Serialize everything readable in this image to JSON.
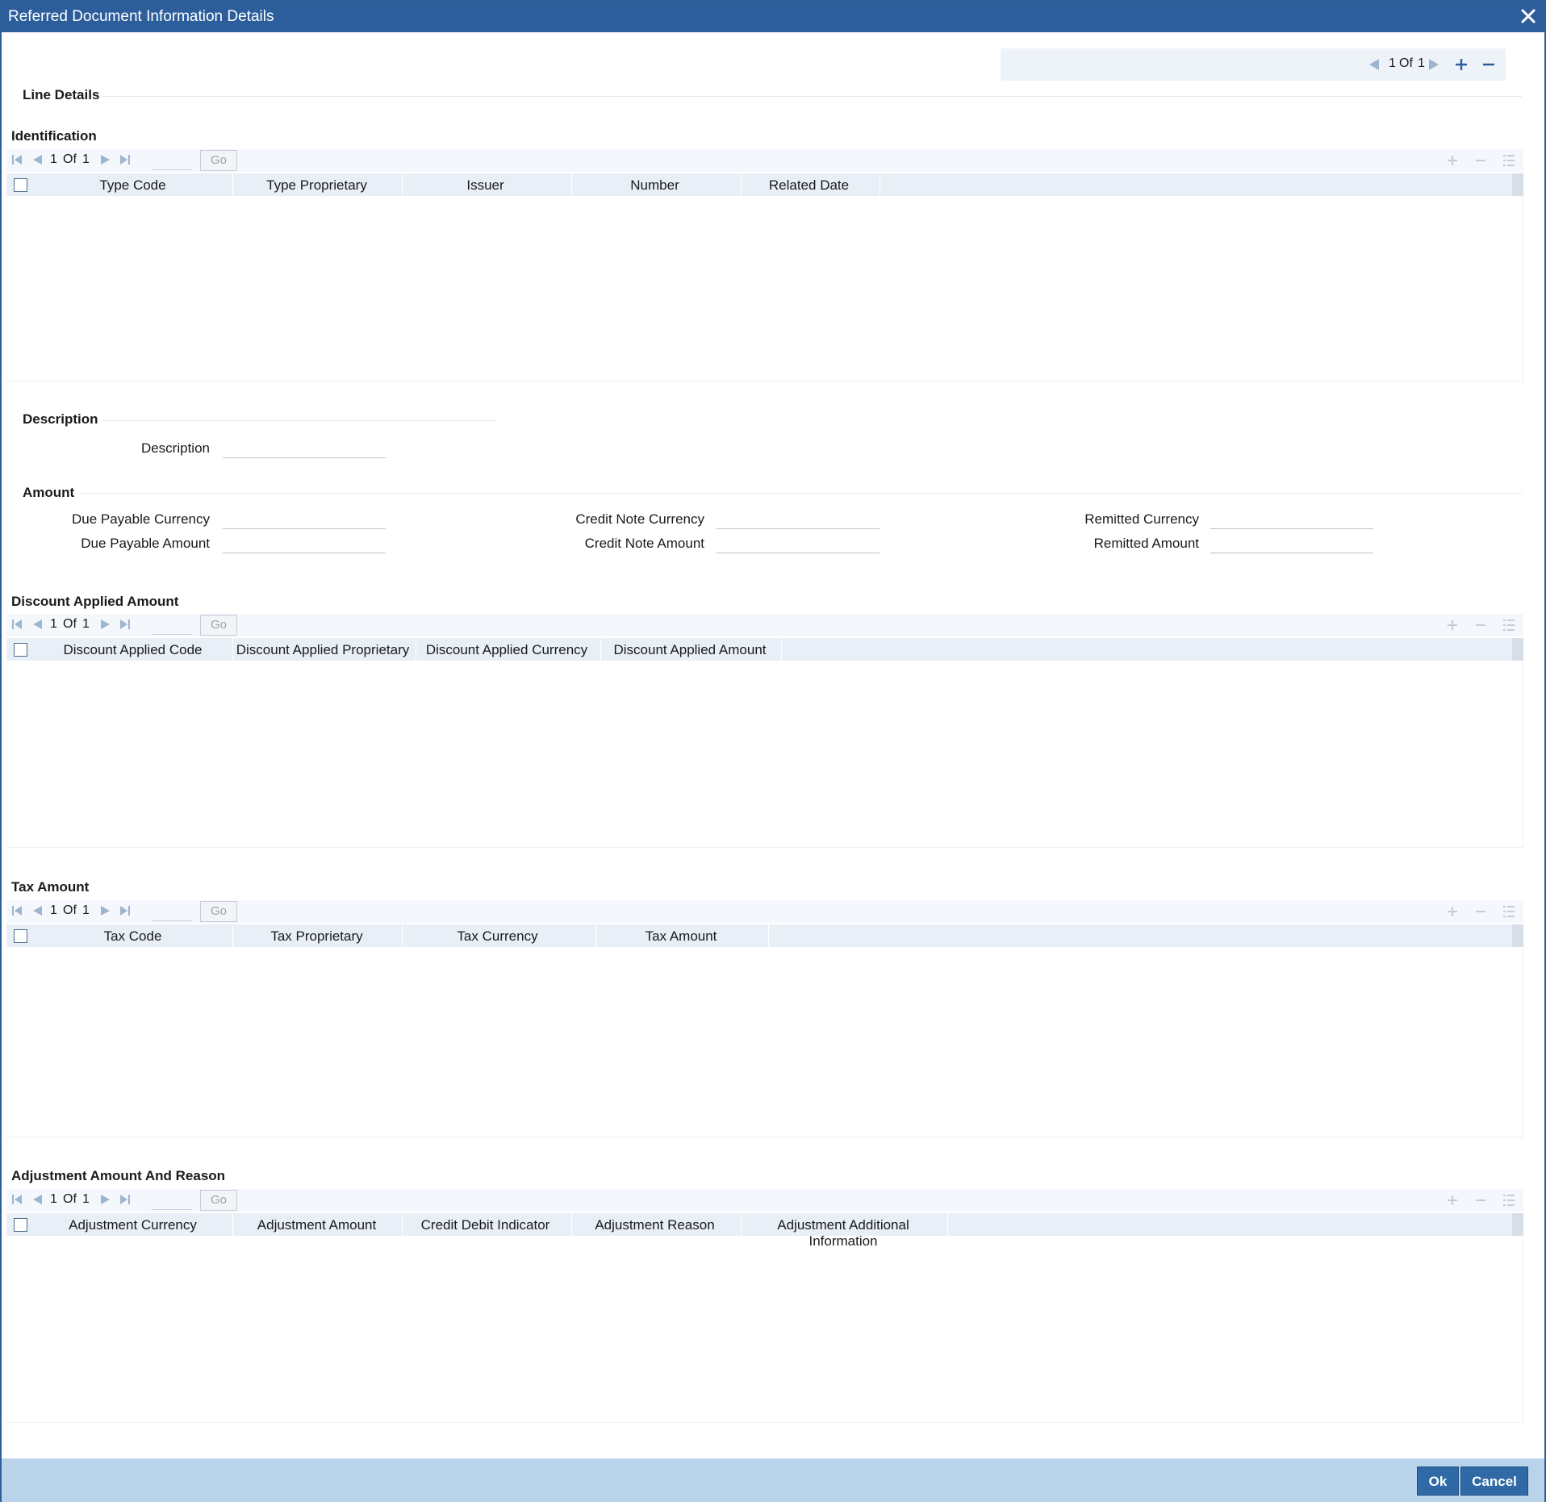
{
  "window": {
    "title": "Referred Document Information Details"
  },
  "record_nav": {
    "current": "1",
    "of_label": "Of",
    "total": "1"
  },
  "line_details": {
    "title": "Line Details"
  },
  "identification": {
    "title": "Identification",
    "pager": {
      "current": "1",
      "of_label": "Of",
      "total": "1",
      "go_label": "Go"
    },
    "columns": [
      "Type Code",
      "Type Proprietary",
      "Issuer",
      "Number",
      "Related Date"
    ]
  },
  "description": {
    "title": "Description",
    "description_label": "Description",
    "description_value": ""
  },
  "amount": {
    "title": "Amount",
    "due_payable_currency_label": "Due Payable Currency",
    "due_payable_amount_label": "Due Payable Amount",
    "credit_note_currency_label": "Credit Note Currency",
    "credit_note_amount_label": "Credit Note Amount",
    "remitted_currency_label": "Remitted Currency",
    "remitted_amount_label": "Remitted Amount"
  },
  "discount_applied_amount": {
    "title": "Discount Applied Amount",
    "pager": {
      "current": "1",
      "of_label": "Of",
      "total": "1",
      "go_label": "Go"
    },
    "columns": [
      "Discount Applied Code",
      "Discount Applied Proprietary",
      "Discount Applied Currency",
      "Discount Applied Amount"
    ]
  },
  "tax_amount": {
    "title": "Tax Amount",
    "pager": {
      "current": "1",
      "of_label": "Of",
      "total": "1",
      "go_label": "Go"
    },
    "columns": [
      "Tax Code",
      "Tax Proprietary",
      "Tax Currency",
      "Tax Amount"
    ]
  },
  "adjustment": {
    "title": "Adjustment Amount And Reason",
    "pager": {
      "current": "1",
      "of_label": "Of",
      "total": "1",
      "go_label": "Go"
    },
    "columns": [
      "Adjustment Currency",
      "Adjustment Amount",
      "Credit Debit Indicator",
      "Adjustment Reason",
      "Adjustment Additional Information"
    ]
  },
  "footer": {
    "ok_label": "Ok",
    "cancel_label": "Cancel"
  },
  "colors": {
    "titlebar": "#2d5e9c",
    "footer": "#b9d3ea",
    "button": "#2f6aa6",
    "header_row": "#e9eff7"
  }
}
